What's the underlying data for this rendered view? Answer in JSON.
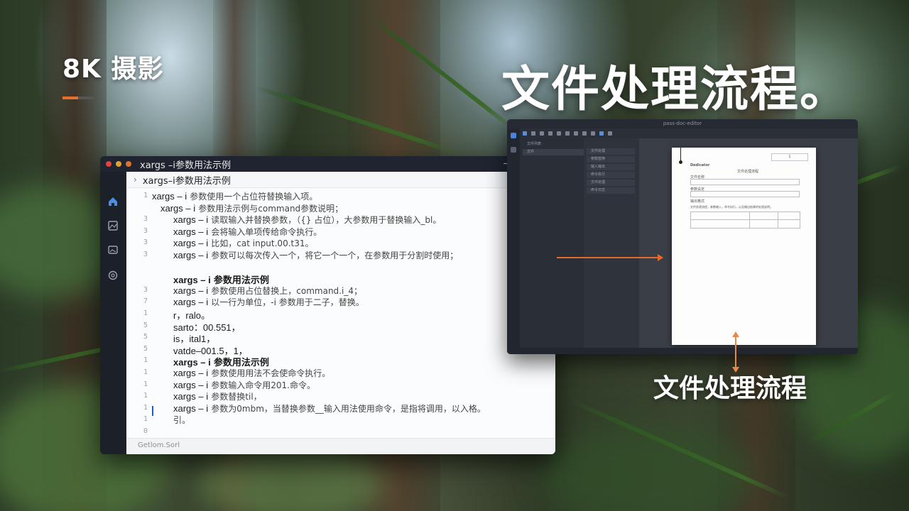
{
  "overlay": {
    "brand": "8K 摄影",
    "headline": "文件处理流程。",
    "caption": "文件处理流程"
  },
  "colors": {
    "accent_orange": "#e86a2a",
    "terminal_bg": "#1f2430",
    "editor_bg": "#fbfcfd",
    "link_blue": "#1a5bd6"
  },
  "terminal": {
    "title": "xargs –i参数用法示例",
    "path": "xargs–i参数用法示例",
    "window_controls": {
      "minimize": "—",
      "maximize": "☐",
      "close": "✕"
    },
    "sidebar_icons": [
      "home-icon",
      "image-icon",
      "gallery-icon",
      "settings-icon"
    ],
    "status": "Getlom.Sorl",
    "lines": [
      {
        "num": "1",
        "kw": "xargs – i",
        "rest": "参数使用一个占位符替换输入项。",
        "bold": false
      },
      {
        "num": "",
        "kw": "xargs – i",
        "rest": "参数用法示例与command参数说明；",
        "bold": false
      },
      {
        "num": "3",
        "kw": "xargs – i",
        "rest": "读取输入并替换参数，（{} 占位），大参数用于替换输入_bl。",
        "bold": false
      },
      {
        "num": "3",
        "kw": "xargs – i",
        "rest": "会将输入单项传给命令执行。",
        "bold": false
      },
      {
        "num": "3",
        "kw": "xargs – i",
        "rest": "比如，cat input.00.t31。",
        "bold": false
      },
      {
        "num": "3",
        "kw": "xargs – i",
        "rest": "参数可以每次传入一个，将它一个一个，在参数用于分割时使用；",
        "bold": false
      },
      {
        "num": "",
        "kw": "",
        "rest": "",
        "bold": false
      },
      {
        "num": "",
        "kw": "xargs – i",
        "rest": "参数用法示例",
        "bold": true
      },
      {
        "num": "3",
        "kw": "xargs – i",
        "rest": "参数使用占位替换上，command.i_4；",
        "bold": false
      },
      {
        "num": "7",
        "kw": "xargs – i",
        "rest": "以一行为单位，-i 参数用于二子，替换。",
        "bold": false
      },
      {
        "num": "1",
        "kw": "r，ralo。",
        "rest": "",
        "bold": false
      },
      {
        "num": "5",
        "kw": "sarto：00.551，",
        "rest": "",
        "bold": false
      },
      {
        "num": "5",
        "kw": "is，ital1，",
        "rest": "",
        "bold": false
      },
      {
        "num": "5",
        "kw": "vatde–001.5，1，",
        "rest": "",
        "bold": false
      },
      {
        "num": "1",
        "kw": "xargs – i",
        "rest": "参数用法示例",
        "bold": true
      },
      {
        "num": "1",
        "kw": "xargs – i",
        "rest": "参数使用用法不会使命令执行。",
        "bold": false
      },
      {
        "num": "1",
        "kw": "xargs – i",
        "rest": "参数输入命令用201.命令。",
        "bold": false
      },
      {
        "num": "1",
        "kw": "xargs – i",
        "rest": "参数替换til，",
        "bold": false
      },
      {
        "num": "1",
        "kw": "xargs – i",
        "rest": "参数为0mbm，当替换参数__输入用法使用命令，是指将调用，以入格。",
        "bold": false
      },
      {
        "num": "1",
        "kw": "",
        "rest": "引。",
        "bold": false
      },
      {
        "num": "0",
        "kw": "",
        "rest": "",
        "bold": false
      }
    ]
  },
  "editor": {
    "title": "pass-doc-editor",
    "panel1_rows": [
      "文件列表",
      "文件"
    ],
    "panel2_rows": [
      "文件处理",
      "参数替换",
      "输入输出",
      "命令执行",
      "文件处理",
      "命令日志"
    ],
    "page": {
      "heading": "Dedicator",
      "subheading": "文件处理流程",
      "field_labels": [
        "文件名称",
        "参数设定",
        "输出格式"
      ],
      "note": "文件处理流程，参数输入，命令执行，以及输出结果的处理说明。",
      "dropdown": "1"
    }
  }
}
